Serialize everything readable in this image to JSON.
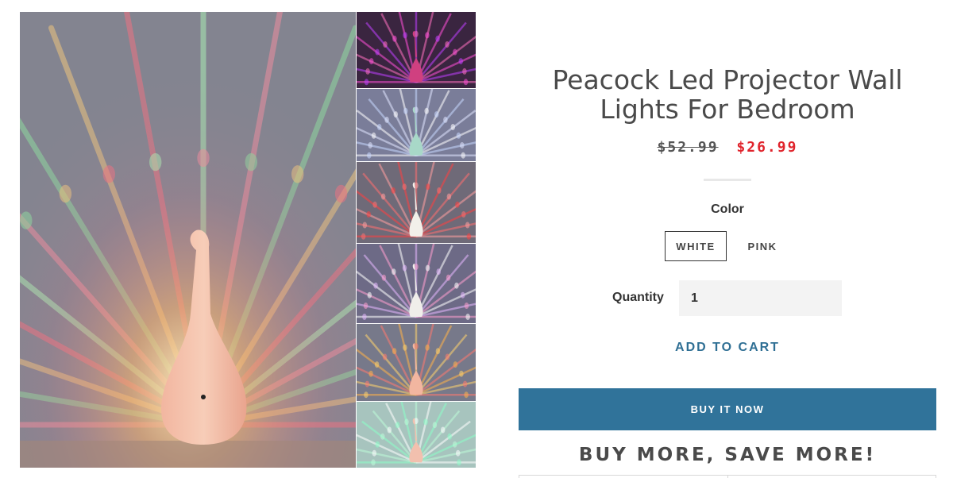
{
  "product": {
    "title": "Peacock Led Projector Wall Lights For Bedroom",
    "price_original": "$52.99",
    "price_sale": "$26.99"
  },
  "variant": {
    "color_label": "Color",
    "options": [
      "WHITE",
      "PINK"
    ],
    "selected": "WHITE"
  },
  "quantity": {
    "label": "Quantity",
    "value": "1"
  },
  "actions": {
    "add_to_cart": "ADD TO CART",
    "buy_now": "BUY IT NOW"
  },
  "promo": {
    "heading": "BUY MORE, SAVE MORE!"
  },
  "colors": {
    "sale_price": "#e0242c",
    "accent_blue": "#30739a",
    "link_blue": "#2f6f94"
  },
  "gallery": {
    "main_image": "peacock-lamp-pink-rainbow-projection",
    "thumbnails": [
      {
        "name": "thumb-pink-purple-projection"
      },
      {
        "name": "thumb-mint-white-projection"
      },
      {
        "name": "thumb-red-projection"
      },
      {
        "name": "thumb-purple-white-projection"
      },
      {
        "name": "thumb-orange-projection"
      },
      {
        "name": "thumb-green-projection"
      }
    ]
  }
}
